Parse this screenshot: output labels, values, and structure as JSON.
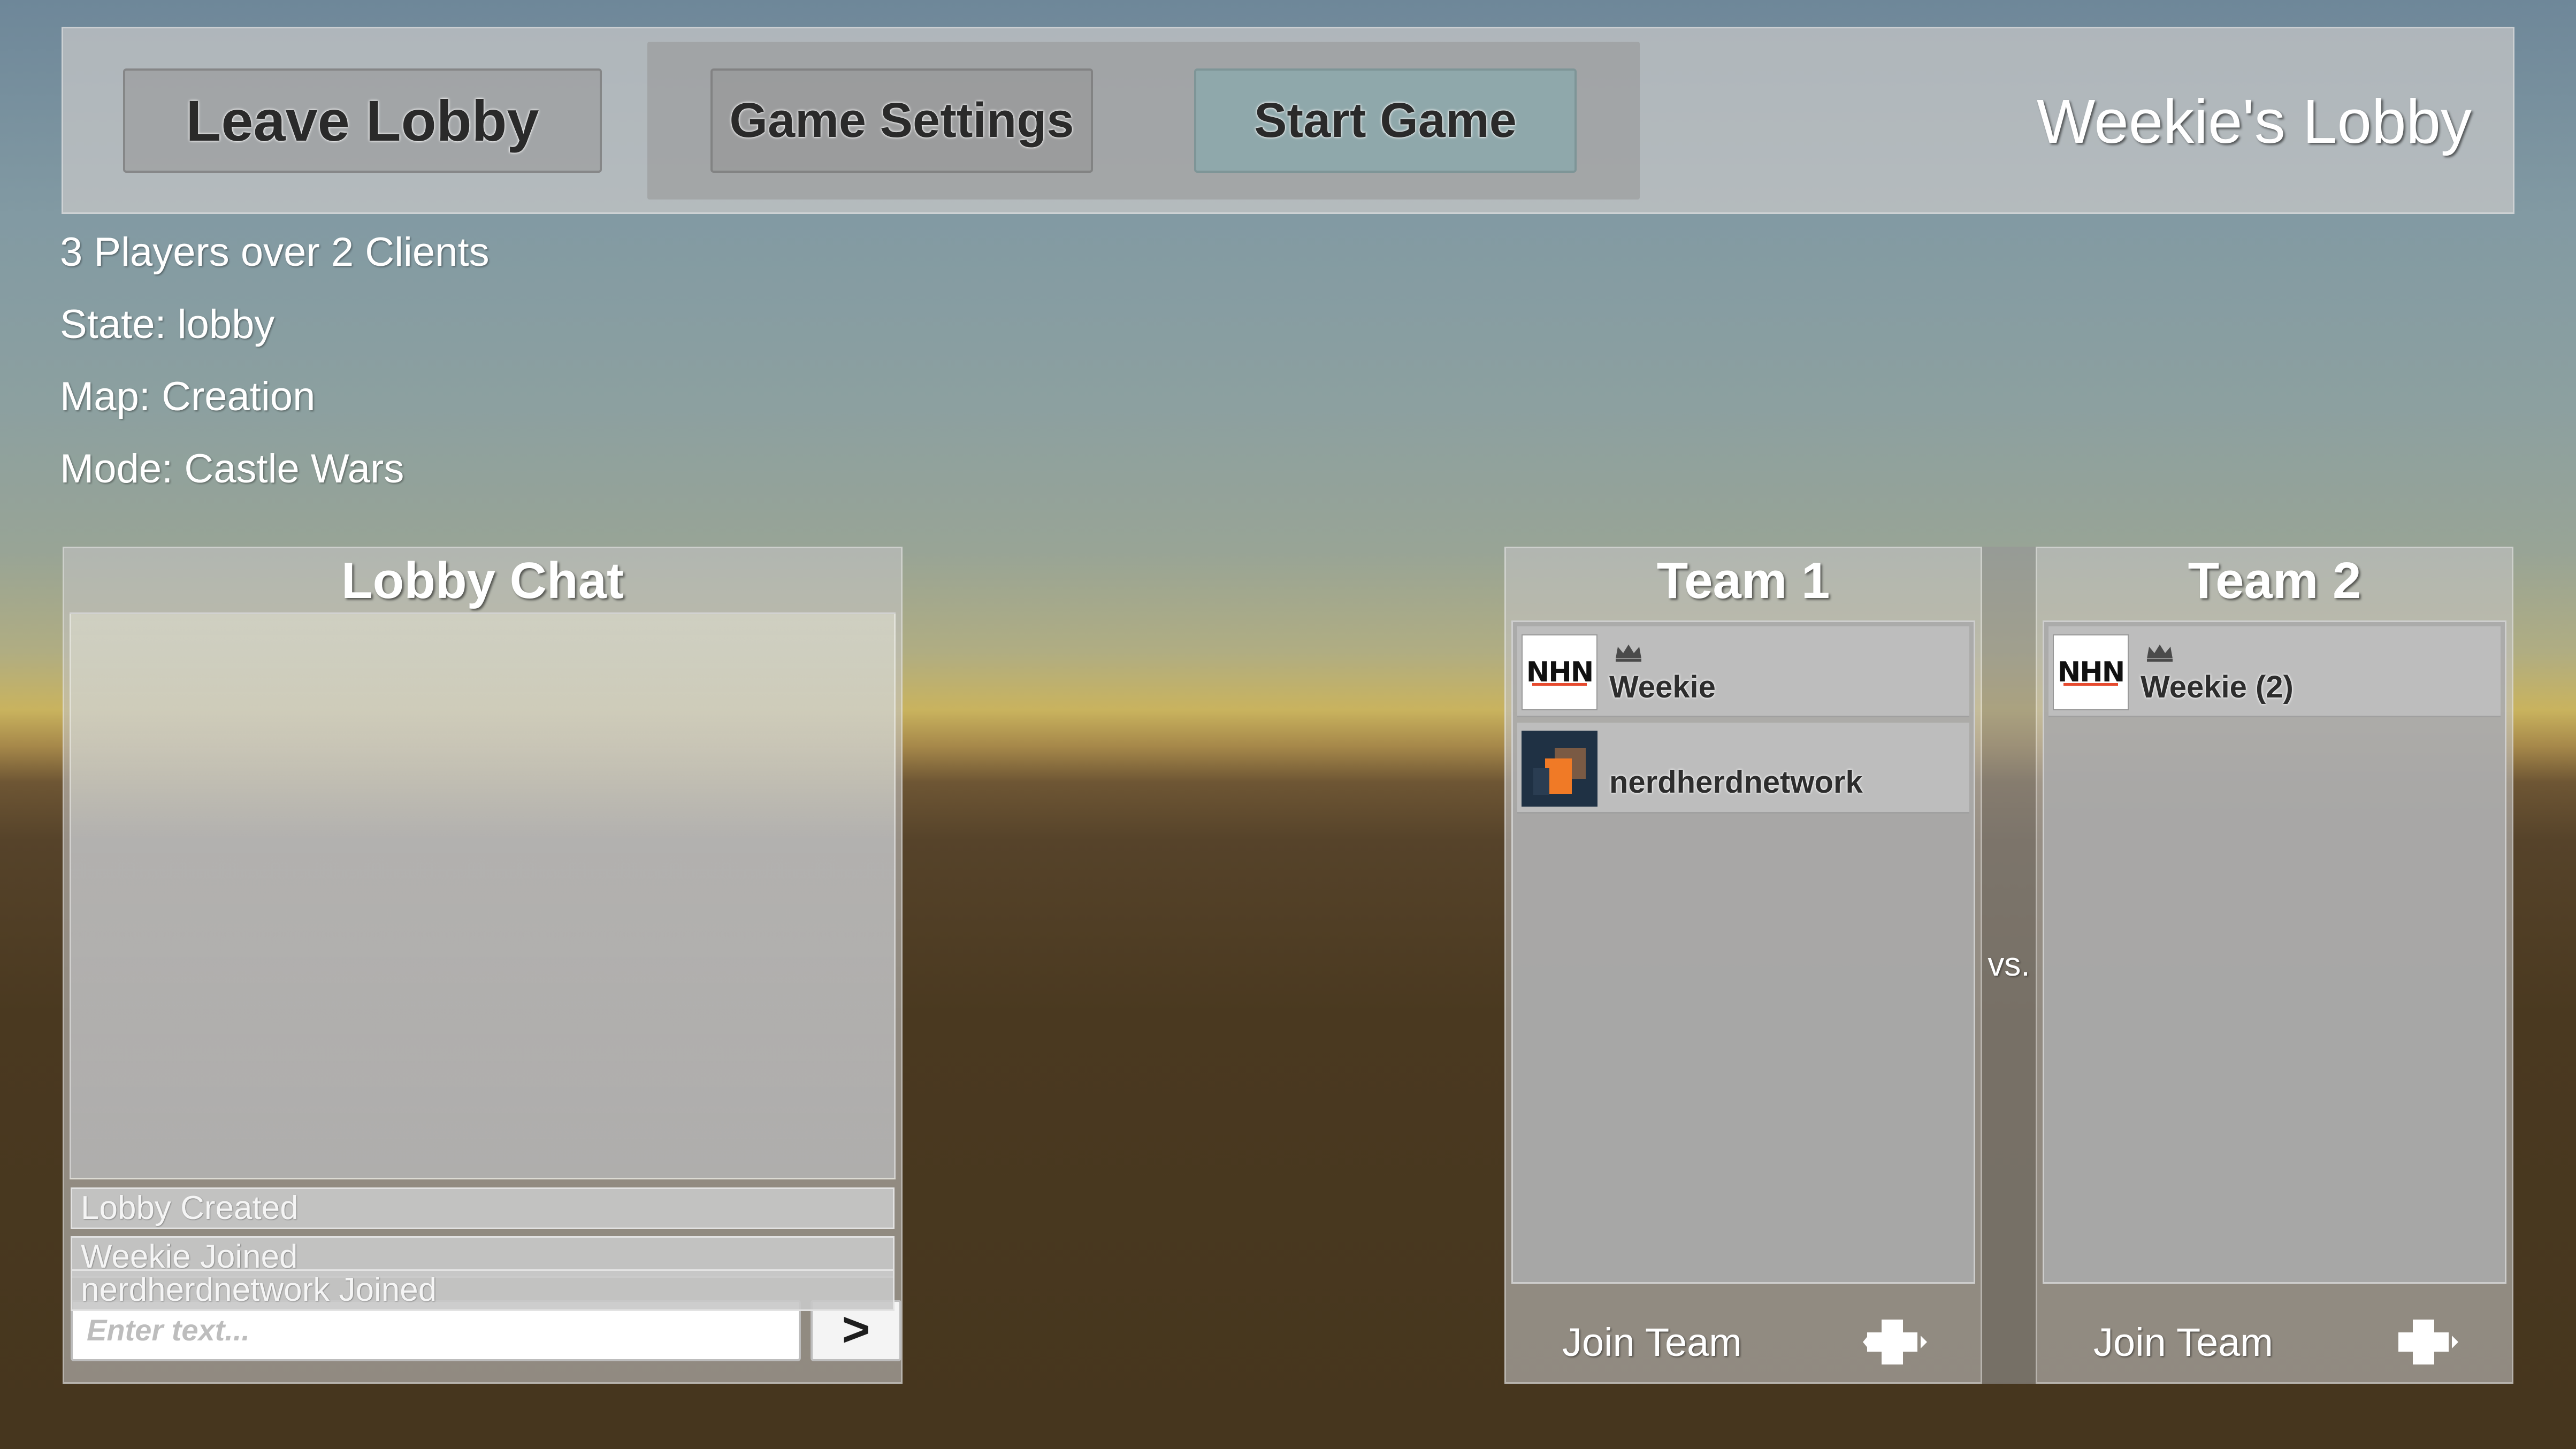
{
  "header": {
    "leave_label": "Leave Lobby",
    "settings_label": "Game Settings",
    "start_label": "Start Game",
    "lobby_title": "Weekie's Lobby"
  },
  "info": {
    "players": "3 Players over 2 Clients",
    "state": "State: lobby",
    "map": "Map: Creation",
    "mode": "Mode: Castle Wars"
  },
  "chat": {
    "title": "Lobby Chat",
    "messages": [
      "Lobby Created",
      "Weekie Joined",
      "nerdherdnetwork Joined"
    ],
    "input_placeholder": "Enter text...",
    "send_label": ">"
  },
  "teams": [
    {
      "title": "Team 1",
      "players": [
        {
          "name": "Weekie",
          "avatar": "nhn-logo",
          "leader": true
        },
        {
          "name": "nerdherdnetwork",
          "avatar": "orange-squares",
          "leader": false
        }
      ],
      "join_label": "Join Team"
    },
    {
      "title": "Team 2",
      "players": [
        {
          "name": "Weekie (2)",
          "avatar": "nhn-logo",
          "leader": true
        }
      ],
      "join_label": "Join Team"
    }
  ],
  "vs_label": "vs.",
  "avatar_logo_text": "NHN",
  "icons": {
    "leader": "crown-icon",
    "join": "plus-icon"
  },
  "colors": {
    "start_button": "#8fa8ab",
    "nhn_accent": "#e64a2e",
    "nerd_avatar_bg": "#1f3144",
    "nerd_avatar_orange": "#f07a26"
  }
}
